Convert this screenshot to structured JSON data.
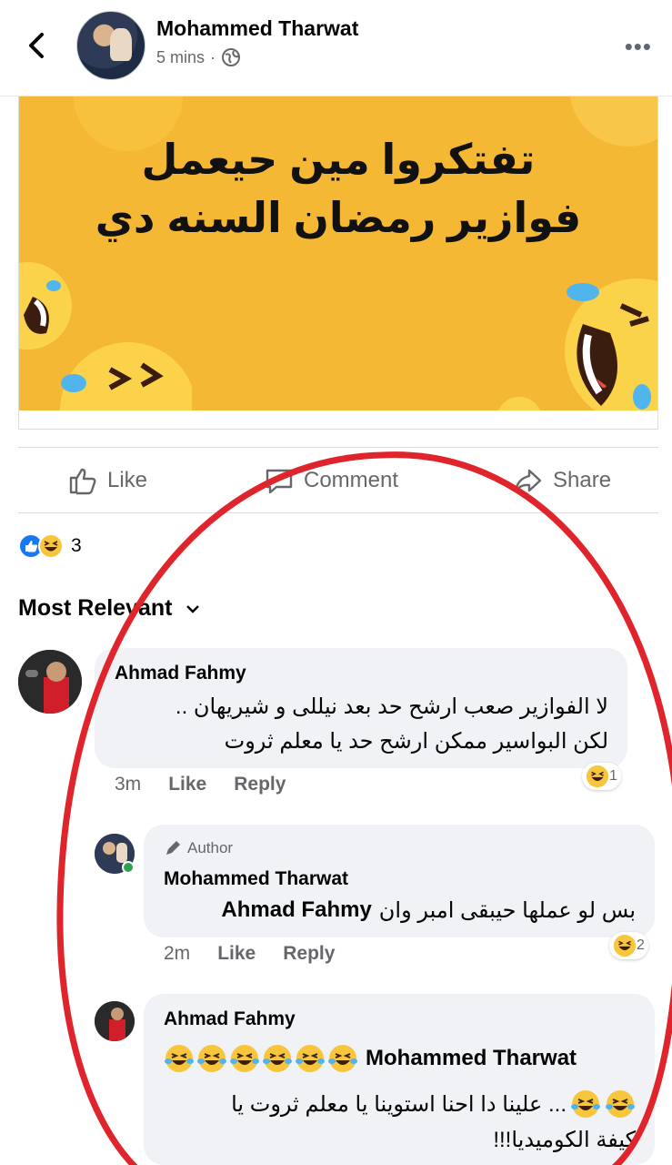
{
  "post": {
    "author_name": "Mohammed Tharwat",
    "time": "5 mins",
    "separator": "·",
    "banner_line1": "تفتكروا مين حيعمل",
    "banner_line2": "فوازير رمضان السنه دي"
  },
  "actions": {
    "like_label": "Like",
    "comment_label": "Comment",
    "share_label": "Share"
  },
  "reactions": {
    "count": "3"
  },
  "sort": {
    "label": "Most Relevant"
  },
  "comments": [
    {
      "name": "Ahmad Fahmy",
      "line1": "لا الفوازير صعب ارشح حد بعد نيللى و شيريهان ..",
      "line2": "لكن البواسير ممكن ارشح حد  يا معلم ثروت",
      "time": "3m",
      "like": "Like",
      "reply": "Reply",
      "react_count": "1"
    },
    {
      "author_tag": "Author",
      "name": "Mohammed Tharwat",
      "mention": "Ahmad Fahmy",
      "text": "بس لو عملها حيبقى امبر وان",
      "time": "2m",
      "like": "Like",
      "reply": "Reply",
      "react_count": "2"
    },
    {
      "name": "Ahmad Fahmy",
      "mention": "Mohammed Tharwat",
      "line2": "... علينا دا احنا استوينا يا معلم ثروت يا",
      "line3": "كيفة الكوميديا!!!"
    }
  ],
  "colors": {
    "banner": "#f5b834",
    "brand_blue": "#1877f2",
    "circle_red": "#e0242c"
  }
}
